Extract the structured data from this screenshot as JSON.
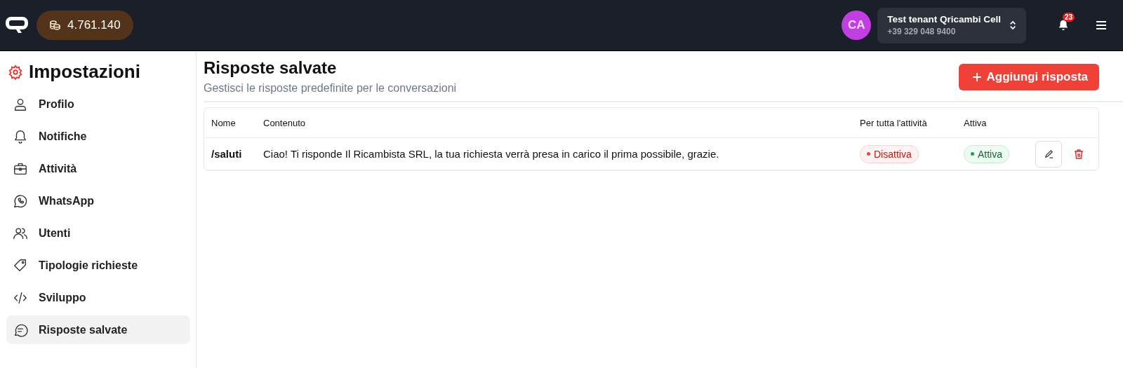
{
  "header": {
    "credits": "4.761.140",
    "avatar": "CA",
    "tenant": {
      "name": "Test tenant Qricambi Cell",
      "phone": "+39 329 048 9400"
    },
    "notifications": "23"
  },
  "sidebar": {
    "title": "Impostazioni",
    "items": [
      {
        "label": "Profilo",
        "selected": false
      },
      {
        "label": "Notifiche",
        "selected": false
      },
      {
        "label": "Attività",
        "selected": false
      },
      {
        "label": "WhatsApp",
        "selected": false
      },
      {
        "label": "Utenti",
        "selected": false
      },
      {
        "label": "Tipologie richieste",
        "selected": false
      },
      {
        "label": "Sviluppo",
        "selected": false
      },
      {
        "label": "Risposte salvate",
        "selected": true
      }
    ]
  },
  "page": {
    "title": "Risposte salvate",
    "subtitle": "Gestisci le risposte predefinite per le conversazioni",
    "add_button": "Aggiungi risposta"
  },
  "table": {
    "columns": [
      "Nome",
      "Contenuto",
      "Per tutta l'attività",
      "Attiva"
    ],
    "rows": [
      {
        "name": "/saluti",
        "content": "Ciao! Ti risponde Il Ricambista SRL, la tua richiesta verrà presa in carico il prima possibile, grazie.",
        "global": {
          "label": "Disattiva",
          "active": false
        },
        "enabled": {
          "label": "Attiva",
          "active": true
        }
      }
    ]
  }
}
